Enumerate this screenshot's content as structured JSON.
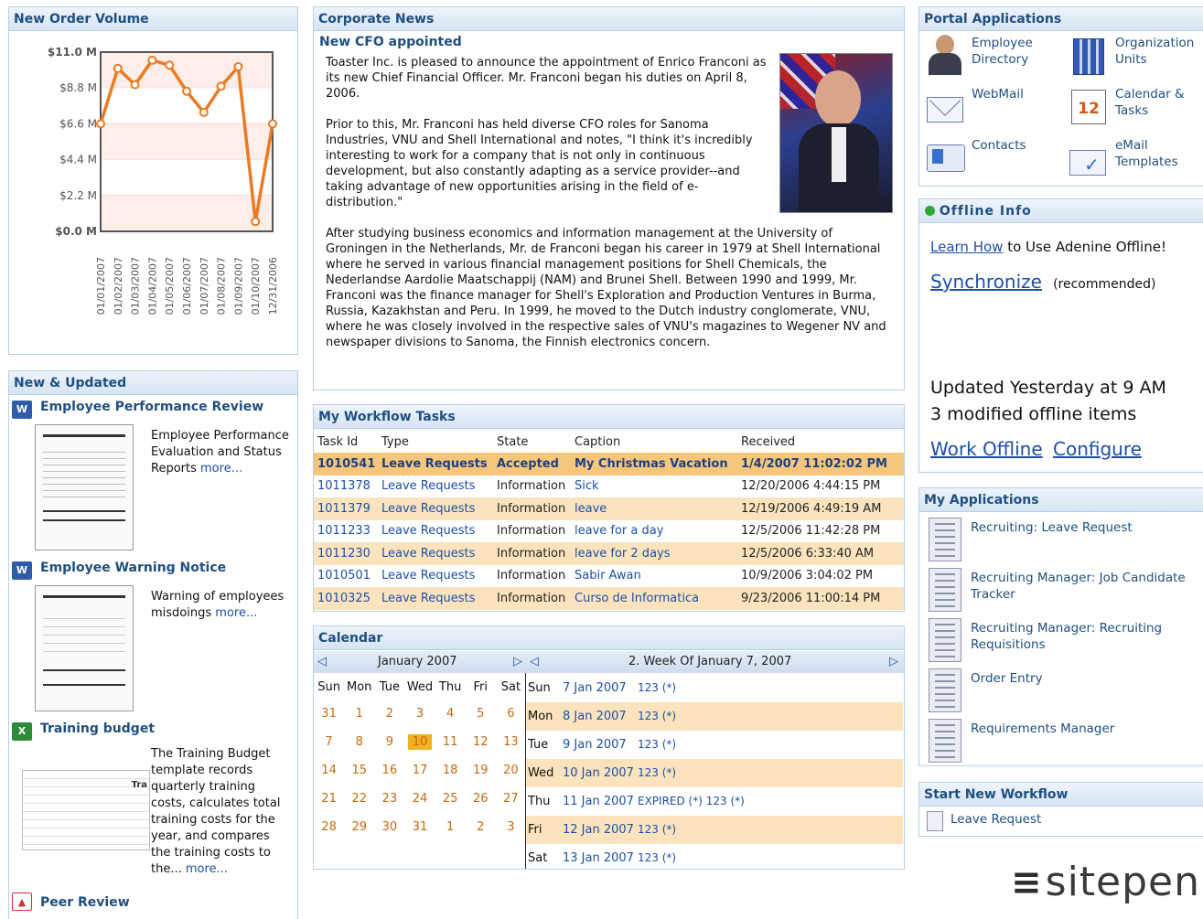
{
  "order_volume": {
    "title": "New Order Volume",
    "chart_data": {
      "type": "line",
      "title": "",
      "xlabel": "",
      "ylabel": "",
      "ylim": [
        0,
        11.0
      ],
      "y_ticks": [
        "$11.0 M",
        "$8.8 M",
        "$6.6 M",
        "$4.4 M",
        "$2.2 M",
        "$0.0 M"
      ],
      "categories": [
        "01/01/2007",
        "01/02/2007",
        "01/03/2007",
        "01/04/2007",
        "01/05/2007",
        "01/06/2007",
        "01/07/2007",
        "01/08/2007",
        "01/09/2007",
        "01/10/2007",
        "12/31/2006"
      ],
      "series": [
        {
          "values": [
            6.6,
            10.0,
            9.0,
            10.5,
            10.2,
            8.6,
            7.3,
            8.9,
            10.1,
            0.6,
            6.6
          ]
        }
      ],
      "grid": true,
      "line_color": "#ec7a22"
    }
  },
  "new_updated": {
    "title": "New & Updated",
    "items": [
      {
        "title": "Employee Performance Review",
        "desc": "Employee Performance Evaluation and Status Reports",
        "more": "more...",
        "icon": "word-doc-icon",
        "icon_text": "W"
      },
      {
        "title": "Employee Warning Notice",
        "desc": "Warning of employees misdoings",
        "more": "more...",
        "icon": "word-doc-icon",
        "icon_text": "W"
      },
      {
        "title": "Training budget",
        "desc": "The Training Budget template records quarterly training costs, calculates total training costs for the year, and compares the training costs to the...",
        "more": "more...",
        "icon": "excel-sheet-icon",
        "icon_text": "X",
        "thumb_text": "Tra"
      },
      {
        "title": "Peer Review",
        "icon": "pdf-icon"
      }
    ]
  },
  "news": {
    "title": "Corporate News",
    "headline": "New CFO appointed",
    "p1": "Toaster Inc. is pleased to announce the appointment of Enrico Franconi as its new Chief Financial Officer. Mr. Franconi began his duties on April 8, 2006.",
    "p2": "Prior to this, Mr. Franconi has held diverse CFO roles for Sanoma Industries, VNU and Shell International and notes, \"I think it's incredibly interesting to work for a company that is not only in continuous development, but also constantly adapting as a service provider--and taking advantage of new opportunities arising in the field of e-distribution.\"",
    "p3": "After studying business economics and information management at the University of Groningen in the Netherlands, Mr. de Franconi began his career in 1979 at Shell International where he served in various financial management positions for Shell Chemicals, the Nederlandse Aardolie Maatschappij (NAM) and Brunei Shell. Between 1990 and 1999, Mr. Franconi was the finance manager for Shell's Exploration and Production Ventures in Burma, Russia, Kazakhstan and Peru. In 1999, he moved to the Dutch industry conglomerate, VNU, where he was closely involved in the respective sales of VNU's magazines to Wegener NV and newspaper divisions to Sanoma, the Finnish electronics concern."
  },
  "workflow": {
    "title": "My Workflow Tasks",
    "columns": [
      "Task Id",
      "Type",
      "State",
      "Caption",
      "Received"
    ],
    "rows": [
      [
        "1010541",
        "Leave Requests",
        "Accepted",
        "My Christmas Vacation",
        "1/4/2007 11:02:02 PM"
      ],
      [
        "1011378",
        "Leave Requests",
        "Information",
        "Sick",
        "12/20/2006 4:44:15 PM"
      ],
      [
        "1011379",
        "Leave Requests",
        "Information",
        "leave",
        "12/19/2006 4:49:19 AM"
      ],
      [
        "1011233",
        "Leave Requests",
        "Information",
        "leave for a day",
        "12/5/2006 11:42:28 PM"
      ],
      [
        "1011230",
        "Leave Requests",
        "Information",
        "leave for 2 days",
        "12/5/2006 6:33:40 AM"
      ],
      [
        "1010501",
        "Leave Requests",
        "Information",
        "Sabir Awan",
        "10/9/2006 3:04:02 PM"
      ],
      [
        "1010325",
        "Leave Requests",
        "Information",
        "Curso de Informatica",
        "9/23/2006 11:00:14 PM"
      ]
    ]
  },
  "calendar": {
    "title": "Calendar",
    "month_label": "January 2007",
    "week_label": "2. Week Of January 7, 2007",
    "dow": [
      "Sun",
      "Mon",
      "Tue",
      "Wed",
      "Thu",
      "Fri",
      "Sat"
    ],
    "weeks": [
      [
        "31",
        "1",
        "2",
        "3",
        "4",
        "5",
        "6"
      ],
      [
        "7",
        "8",
        "9",
        "10",
        "11",
        "12",
        "13"
      ],
      [
        "14",
        "15",
        "16",
        "17",
        "18",
        "19",
        "20"
      ],
      [
        "21",
        "22",
        "23",
        "24",
        "25",
        "26",
        "27"
      ],
      [
        "28",
        "29",
        "30",
        "31",
        "1",
        "2",
        "3"
      ]
    ],
    "today": "10",
    "week_days": [
      {
        "day": "Sun",
        "date": "7 Jan 2007",
        "item": "123 (*)"
      },
      {
        "day": "Mon",
        "date": "8 Jan 2007",
        "item": "123 (*)"
      },
      {
        "day": "Tue",
        "date": "9 Jan 2007",
        "item": "123 (*)"
      },
      {
        "day": "Wed",
        "date": "10 Jan 2007",
        "item": "123 (*)"
      },
      {
        "day": "Thu",
        "date": "11 Jan 2007",
        "item": "EXPIRED (*) 123 (*)"
      },
      {
        "day": "Fri",
        "date": "12 Jan 2007",
        "item": "123 (*)"
      },
      {
        "day": "Sat",
        "date": "13 Jan 2007",
        "item": "123 (*)"
      }
    ]
  },
  "portal": {
    "title": "Portal Applications",
    "items": [
      {
        "label": "Employee Directory",
        "icon": "employee-directory-icon"
      },
      {
        "label": "Organization Units",
        "icon": "organization-units-icon"
      },
      {
        "label": "WebMail",
        "icon": "webmail-icon"
      },
      {
        "label": "Calendar & Tasks",
        "icon": "calendar-icon",
        "icon_text": "12"
      },
      {
        "label": "Contacts",
        "icon": "contacts-icon"
      },
      {
        "label": "eMail Templates",
        "icon": "email-templates-icon"
      }
    ]
  },
  "offline": {
    "title": "Offline Info",
    "learn_link": "Learn How",
    "learn_rest": "to Use Adenine Offline!",
    "sync_link": "Synchronize",
    "sync_note": "(recommended)",
    "updated": "Updated Yesterday at 9 AM",
    "modified": "3 modified offline items",
    "work_offline": "Work Offline",
    "configure": "Configure",
    "status_color": "#2ea82e"
  },
  "my_apps": {
    "title": "My Applications",
    "items": [
      "Recruiting: Leave Request",
      "Recruiting Manager: Job Candidate Tracker",
      "Recruiting Manager: Recruiting Requisitions",
      "Order Entry",
      "Requirements Manager"
    ]
  },
  "start_workflow": {
    "title": "Start New Workflow",
    "item": "Leave Request"
  },
  "logo": {
    "text": "sitepen",
    "mark": "≡"
  }
}
